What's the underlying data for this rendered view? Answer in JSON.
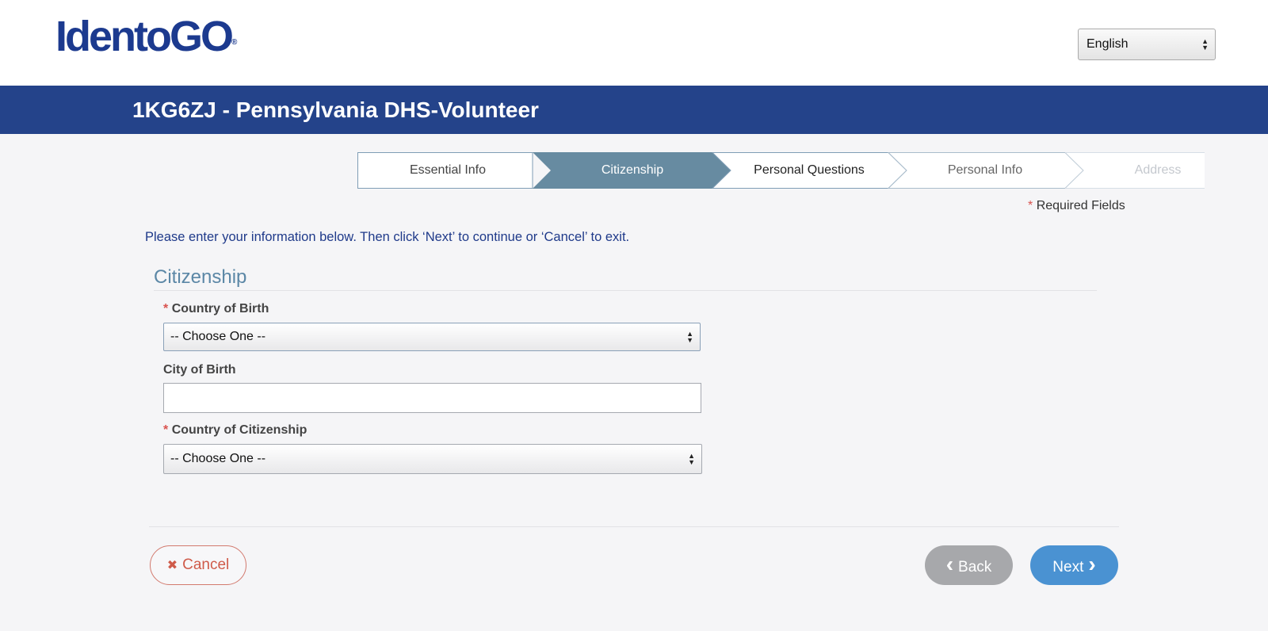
{
  "header": {
    "logo_text": "IdentoGO",
    "logo_reg": "®",
    "language_selected": "English"
  },
  "title_bar": {
    "title": "1KG6ZJ - Pennsylvania DHS-Volunteer"
  },
  "steps": [
    {
      "label": "Essential Info",
      "state": "completed"
    },
    {
      "label": "Citizenship",
      "state": "active"
    },
    {
      "label": "Personal Questions",
      "state": "upcoming"
    },
    {
      "label": "Personal Info",
      "state": "upcoming"
    },
    {
      "label": "Address",
      "state": "disabled"
    }
  ],
  "required_note": {
    "star": "*",
    "text": "Required Fields"
  },
  "instructions": "Please enter your information below. Then click ‘Next’ to continue or ‘Cancel’ to exit.",
  "form": {
    "section_title": "Citizenship",
    "country_of_birth": {
      "star": "*",
      "label": "Country of Birth",
      "value": "-- Choose One --"
    },
    "city_of_birth": {
      "label": "City of Birth",
      "value": ""
    },
    "country_of_citizenship": {
      "star": "*",
      "label": "Country of Citizenship",
      "value": "-- Choose One --"
    }
  },
  "buttons": {
    "cancel_icon": "✖",
    "cancel_label": "Cancel",
    "back_icon": "‹",
    "back_label": "Back",
    "next_label": "Next",
    "next_icon": "›"
  },
  "colors": {
    "brand_blue": "#24438a",
    "active_step": "#678ba1",
    "next_button": "#4a92d2",
    "back_button": "#a7a8ab",
    "cancel": "#cf5b4a"
  }
}
